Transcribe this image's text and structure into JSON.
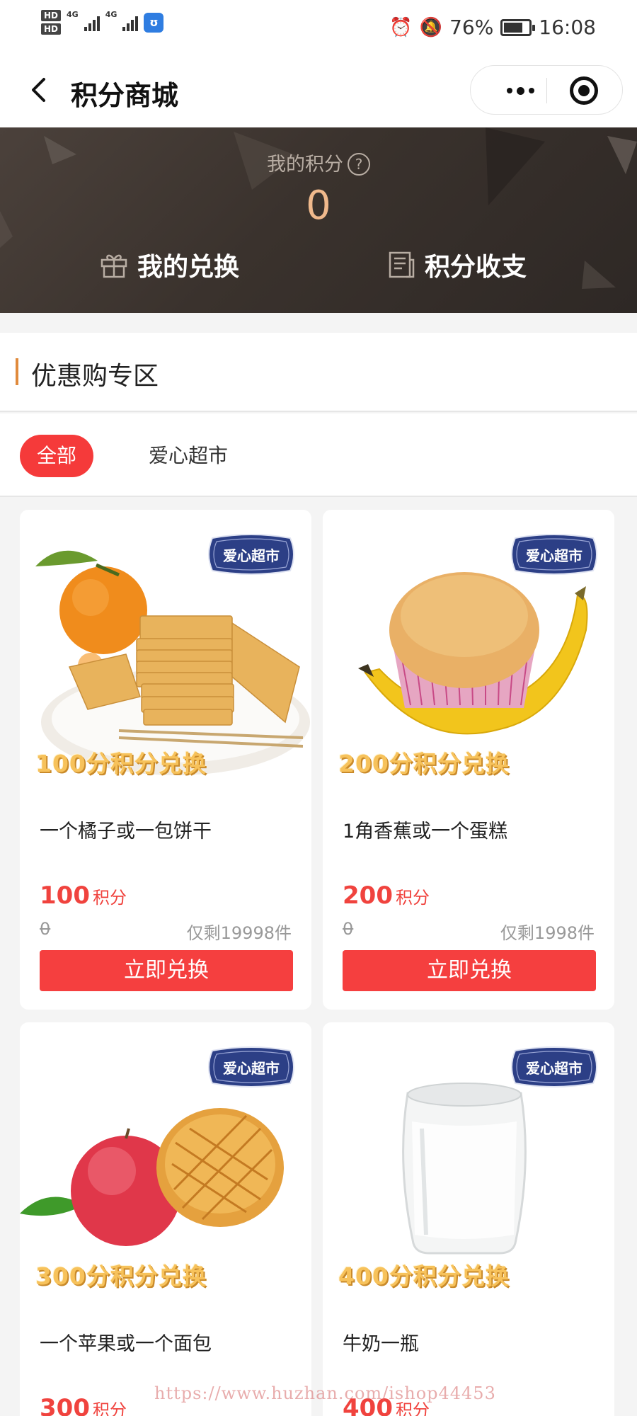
{
  "status_bar": {
    "hd1": "HD",
    "hd2": "HD",
    "net1": "4G",
    "net2": "4G",
    "app_badge": "ʊ",
    "battery_percent": "76%",
    "battery_level": 0.76,
    "time": "16:08"
  },
  "nav": {
    "title": "积分商城"
  },
  "banner": {
    "points_label": "我的积分",
    "help_glyph": "?",
    "points_value": "0",
    "exchange_label": "我的兑换",
    "ledger_label": "积分收支"
  },
  "section": {
    "title": "优惠购专区"
  },
  "filters": {
    "all": "全部",
    "shop": "爱心超市"
  },
  "products": [
    {
      "promo": "100分积分兑换",
      "name": "一个橘子或一包饼干",
      "price": "100",
      "unit": "积分",
      "original": "0",
      "stock": "仅剩19998件",
      "button": "立即兑换",
      "badge": "爱心超市"
    },
    {
      "promo": "200分积分兑换",
      "name": "1角香蕉或一个蛋糕",
      "price": "200",
      "unit": "积分",
      "original": "0",
      "stock": "仅剩1998件",
      "button": "立即兑换",
      "badge": "爱心超市"
    },
    {
      "promo": "300分积分兑换",
      "name": "一个苹果或一个面包",
      "price": "300",
      "unit": "积分",
      "badge": "爱心超市"
    },
    {
      "promo": "400分积分兑换",
      "name": "牛奶一瓶",
      "price": "400",
      "unit": "积分",
      "badge": "爱心超市"
    }
  ],
  "watermark": "https://www.huzhan.com/ishop44453",
  "colors": {
    "accent_red": "#f53f3f",
    "price_red": "#f0433e",
    "points_orange": "#f0b98c",
    "banner_dark": "#3a322d",
    "section_bar": "#e08a3c"
  }
}
